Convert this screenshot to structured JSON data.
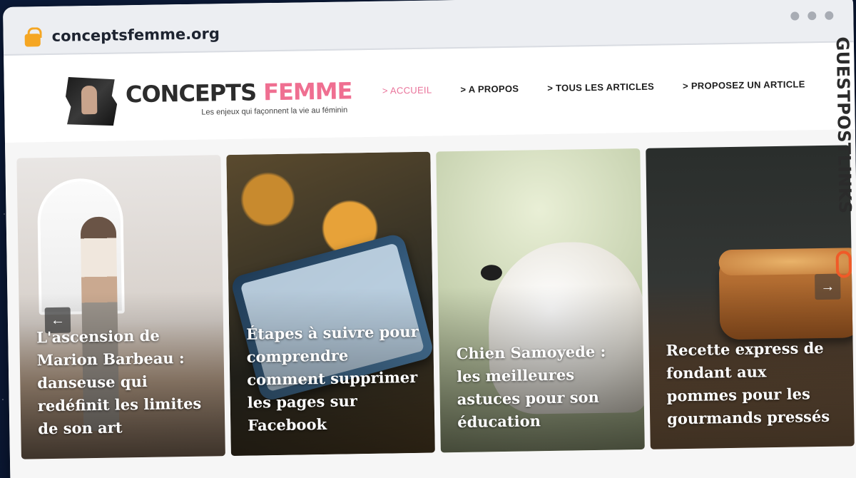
{
  "browser": {
    "url": "conceptsfemme.org"
  },
  "site": {
    "logo_word1": "CONCEPTS",
    "logo_word2": "FEMME",
    "tagline": "Les enjeux qui façonnent la vie au féminin"
  },
  "nav": {
    "items": [
      {
        "label": "> ACCUEIL",
        "active": true
      },
      {
        "label": "> A PROPOS"
      },
      {
        "label": "> TOUS LES ARTICLES"
      },
      {
        "label": "> PROPOSEZ UN ARTICLE"
      }
    ]
  },
  "carousel": {
    "prev_icon": "arrow-left-icon",
    "next_icon": "arrow-right-icon",
    "cards": [
      {
        "title": "L'ascension de Marion Barbeau : danseuse qui redéfinit les limites de son art"
      },
      {
        "title": "Étapes à suivre pour comprendre comment supprimer les pages sur Facebook"
      },
      {
        "title": "Chien Samoyede : les meilleures astuces pour son éducation"
      },
      {
        "title": "Recette express de fondant aux pommes pour les gourmands pressés"
      }
    ]
  },
  "watermark": {
    "text": "GUESTPOSTLINKS"
  },
  "colors": {
    "accent_pink": "#ef6f91",
    "lock": "#f5a623",
    "watermark_orange": "#f05a28"
  }
}
